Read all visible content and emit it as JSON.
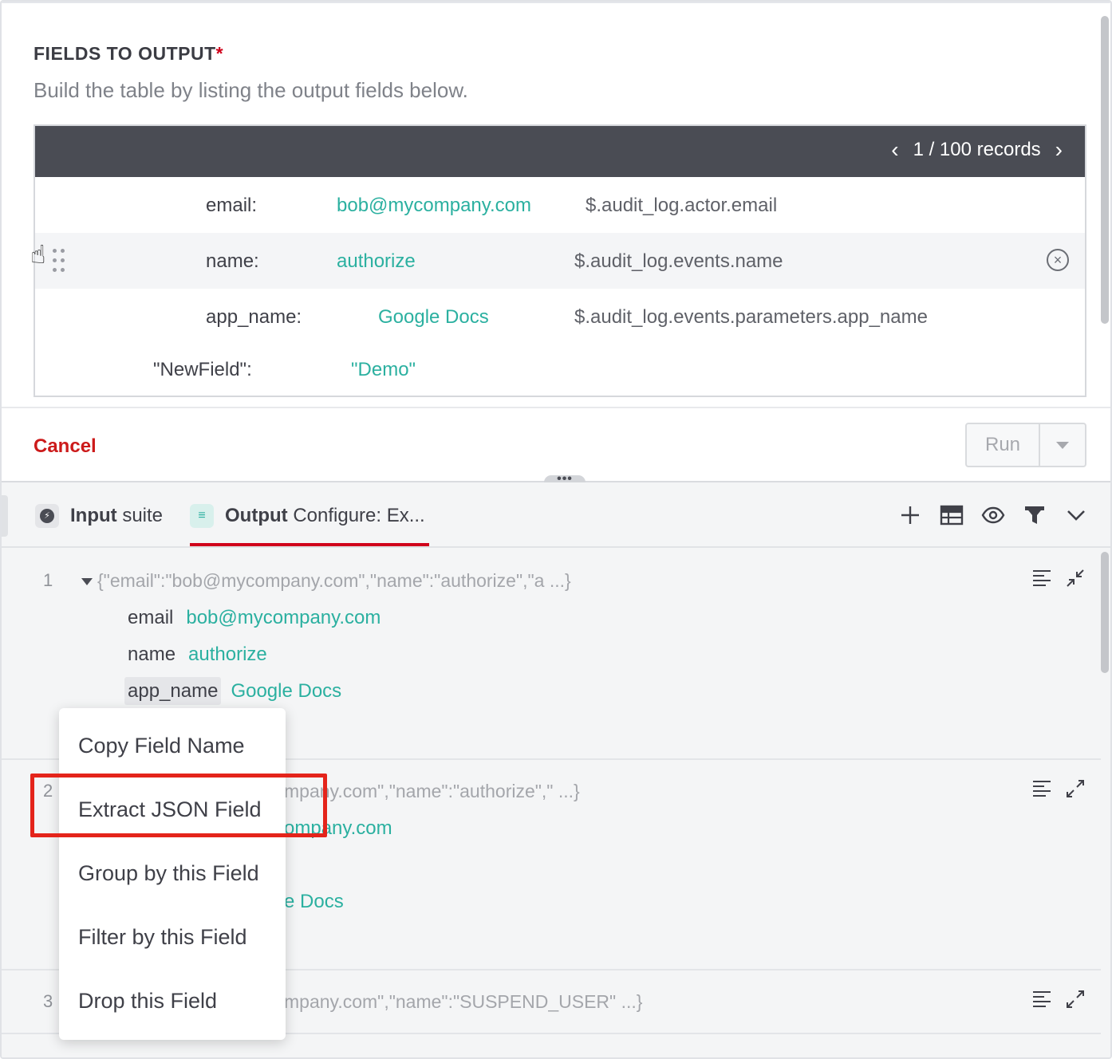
{
  "form": {
    "title": "FIELDS TO OUTPUT",
    "required_mark": "*",
    "description": "Build the table by listing the output fields below.",
    "records_nav": "1 / 100 records",
    "rows": [
      {
        "key": "email:",
        "value": "bob@mycompany.com",
        "path": "$.audit_log.actor.email"
      },
      {
        "key": "name:",
        "value": "authorize",
        "path": "$.audit_log.events.name"
      },
      {
        "key": "app_name:",
        "value": "Google Docs",
        "path": "$.audit_log.events.parameters.app_name"
      },
      {
        "key": "\"NewField\":",
        "value": "\"Demo\"",
        "path": ""
      }
    ]
  },
  "actions": {
    "cancel_label": "Cancel",
    "run_label": "Run"
  },
  "tabs": {
    "input_bold": "Input",
    "input_rest": "suite",
    "output_bold": "Output",
    "output_rest": "Configure: Ex..."
  },
  "toolbar_icons": [
    "plus-icon",
    "table-icon",
    "eye-icon",
    "filter-icon",
    "chevron-down-icon"
  ],
  "results": [
    {
      "num": "1",
      "summary": "{\"email\":\"bob@mycompany.com\",\"name\":\"authorize\",\"a ...}",
      "fields": [
        {
          "key": "email",
          "value": "bob@mycompany.com"
        },
        {
          "key": "name",
          "value": "authorize"
        },
        {
          "key": "app_name",
          "value": "Google Docs"
        }
      ]
    },
    {
      "num": "2",
      "summary": "mpany.com\",\"name\":\"authorize\",\" ...}",
      "fields": [
        {
          "value": "ompany.com"
        },
        {
          "value": "e Docs"
        }
      ]
    },
    {
      "num": "3",
      "summary": "mpany.com\",\"name\":\"SUSPEND_USER\" ...}"
    }
  ],
  "context_menu": {
    "items": [
      "Copy Field Name",
      "Extract JSON Field",
      "Group by this Field",
      "Filter by this Field",
      "Drop this Field"
    ],
    "highlighted": "Extract JSON Field"
  },
  "colors": {
    "accent_teal": "#2bb0a0",
    "danger_red": "#d0021b",
    "header_dark": "#4a4c54",
    "highlight_box": "#e4241b"
  }
}
